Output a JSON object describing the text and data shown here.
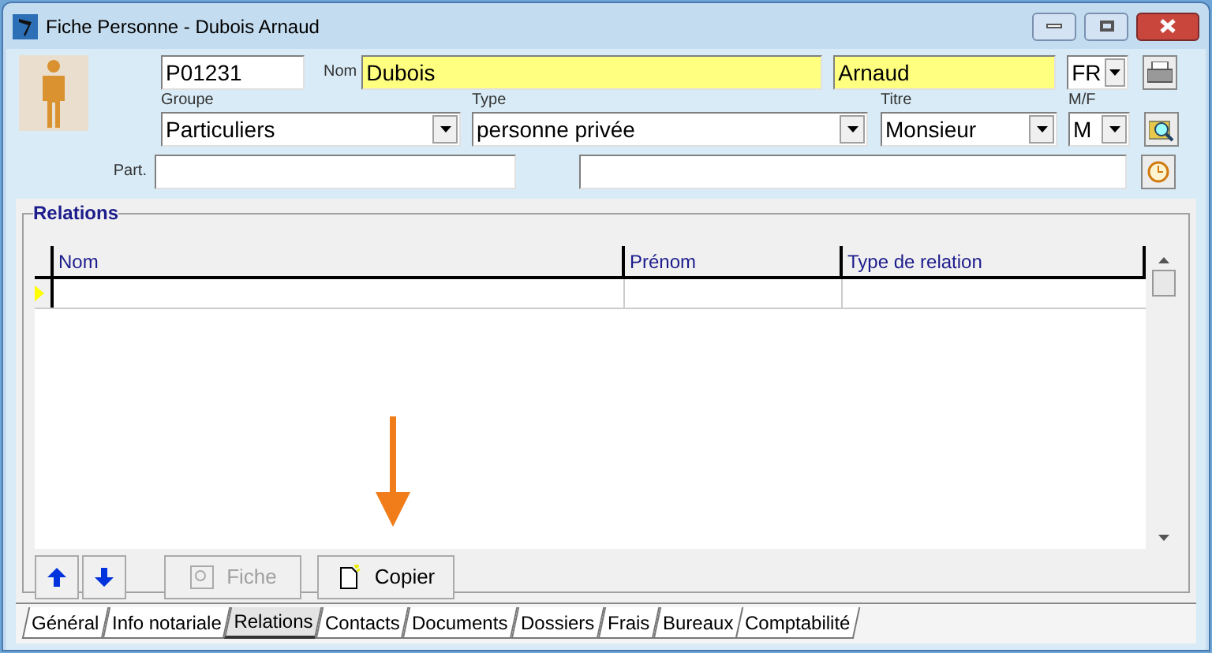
{
  "window": {
    "title": "Fiche Personne - Dubois Arnaud"
  },
  "form": {
    "id": "P01231",
    "nom_label": "Nom",
    "nom": {
      "value": "Dubois",
      "highlighted": true
    },
    "prenom": {
      "value": "Arnaud",
      "highlighted": true
    },
    "langue": "FR",
    "groupe_label": "Groupe",
    "groupe": "Particuliers",
    "type_label": "Type",
    "type": "personne privée",
    "titre_label": "Titre",
    "titre": "Monsieur",
    "sexe_label": "M/F",
    "sexe": "M",
    "part_label": "Part."
  },
  "relations": {
    "title": "Relations",
    "columns": [
      "Nom",
      "Prénom",
      "Type de relation"
    ],
    "buttons": [
      {
        "label": "Fiche",
        "disabled": true
      },
      {
        "label": "Copier",
        "disabled": false
      }
    ]
  },
  "tabs": [
    {
      "label": "Général",
      "selected": false
    },
    {
      "label": "Info notariale",
      "selected": false
    },
    {
      "label": "Relations",
      "selected": true
    },
    {
      "label": "Contacts",
      "selected": false
    },
    {
      "label": "Documents",
      "selected": false
    },
    {
      "label": "Dossiers",
      "selected": false
    },
    {
      "label": "Frais",
      "selected": false
    },
    {
      "label": "Bureaux",
      "selected": false
    },
    {
      "label": "Comptabilité",
      "selected": false
    }
  ]
}
